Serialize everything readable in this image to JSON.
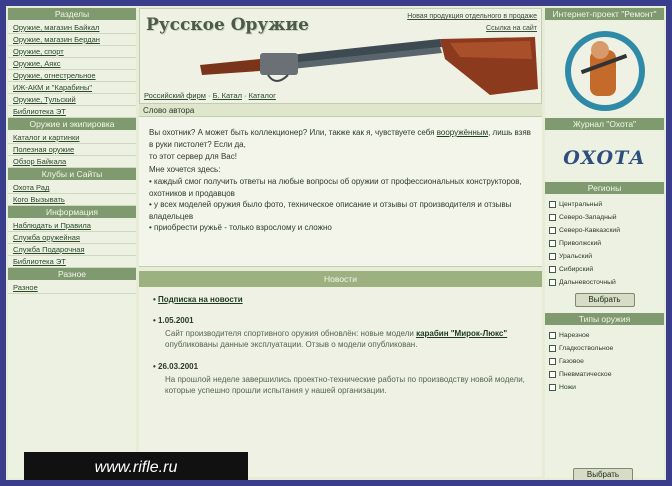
{
  "left_sidebar": {
    "sections": [
      {
        "title": "Разделы",
        "items": [
          "Оружие, магазин Байкал",
          "Оружие, магазин Бердан",
          "Оружие, спорт",
          "Оружие, Аякс",
          "Оружие, огнестрельное",
          "ИЖ-АКМ и \"Карабины\"",
          "Оружие, Тульский",
          "Библиотека ЭТ"
        ]
      },
      {
        "title": "Оружие и экипировка",
        "items": [
          "Каталог и картинки",
          "Полезная оружие",
          "Обзор Байкала"
        ]
      },
      {
        "title": "Клубы и Сайты",
        "items": [
          "Охота Рад",
          "Кого Вызывать"
        ]
      },
      {
        "title": "Информация",
        "items": [
          "Наблюдать и Правила",
          "Служба оружейная",
          "Служба Подарочная",
          "Библиотека ЭТ"
        ]
      },
      {
        "title": "Разное",
        "items": [
          "Разное"
        ]
      }
    ]
  },
  "header": {
    "site_title": "Русское Оружие",
    "top_links": [
      "Новая продукция отдельного в продаже",
      "Ссылка на сайт"
    ],
    "breadcrumbs": [
      "Российский фирм",
      "Б. Катал",
      "Каталог"
    ],
    "subline": "Слово автора"
  },
  "intro": {
    "p1_a": "Вы охотник? А может быть коллекционер? Или, также как я,",
    "p1_b": "чувствуете себя",
    "p1_link": "вооружённым",
    "p1_c": ", лишь взяв в руки пистолет? Если да,",
    "p2": "то этот сервер для Вас!",
    "p3": "Мне хочется здесь:",
    "bullets": [
      "каждый смог получить ответы на любые вопросы об оружии от профессиональных конструкторов, охотников и продавцов",
      "у всех моделей оружия было фото, техническое описание и отзывы от производителя и отзывы владельцев",
      "приобрести ружьё - только взрослому и сложно"
    ]
  },
  "news": {
    "header": "Новости",
    "subscribe": "Подписка на новости",
    "items": [
      {
        "date": "1.05.2001",
        "desc_a": "Сайт производителя спортивного оружия обновлён: новые модели",
        "desc_link": "карабин \"Мирок-Люкс\"",
        "desc_b": "опубликованы данные эксплуатации. Отзыв о модели опубликован."
      },
      {
        "date": "26.03.2001",
        "desc_a": "На прошлой неделе завершились проектно-технические работы по производству новой модели, которые успешно прошли",
        "desc_link": "",
        "desc_b": "испытания у нашей организации."
      }
    ]
  },
  "right_sidebar": {
    "partner_title": "Интернет-проект \"Ремонт\"",
    "okhota_title": "Журнал \"Охота\"",
    "okhota_logo": "ОХОТА",
    "region_title": "Регионы",
    "regions": [
      "Центральный",
      "Северо-Западный",
      "Северо-Кавказский",
      "Приволжский",
      "Уральский",
      "Сибирский",
      "Дальневосточный"
    ],
    "button": "Выбрать",
    "type_title": "Типы оружия",
    "types": [
      "Нарезное",
      "Гладкоствольное",
      "Газовое",
      "Пневматическое",
      "Ножи"
    ],
    "button2": "Выбрать"
  },
  "url_badge": "www.rifle.ru",
  "colors": {
    "frame": "#3a3c8c",
    "section_header": "#7f9a6e",
    "page_bg": "#e6ecd6"
  }
}
